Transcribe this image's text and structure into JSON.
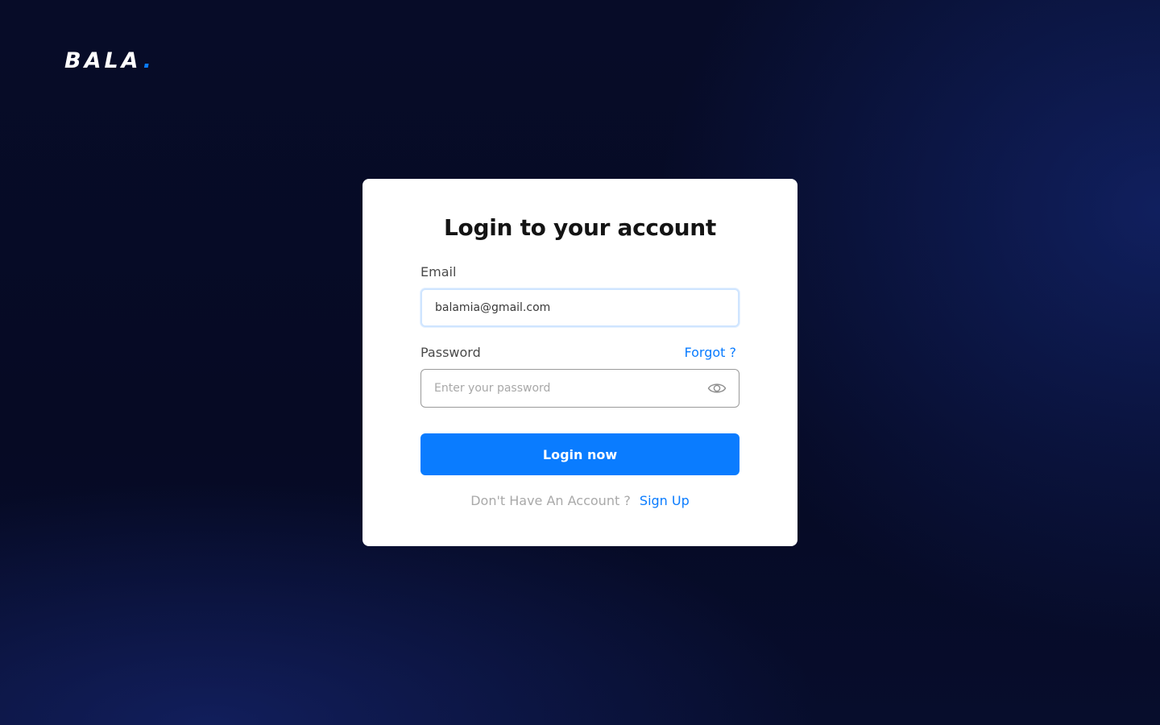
{
  "brand": {
    "name": "BALA",
    "dot": ".",
    "accent_color": "#0a7cff"
  },
  "login_card": {
    "title": "Login to your account",
    "email": {
      "label": "Email",
      "value": "balamia@gmail.com"
    },
    "password": {
      "label": "Password",
      "placeholder": "Enter your password",
      "value": "",
      "toggle_icon": "eye-icon"
    },
    "forgot_label": "Forgot ?",
    "submit_label": "Login now",
    "signup_prompt": "Don't Have An Account ?",
    "signup_link": "Sign Up"
  },
  "colors": {
    "background": "#060b26",
    "primary": "#0a7cff",
    "card": "#ffffff"
  }
}
